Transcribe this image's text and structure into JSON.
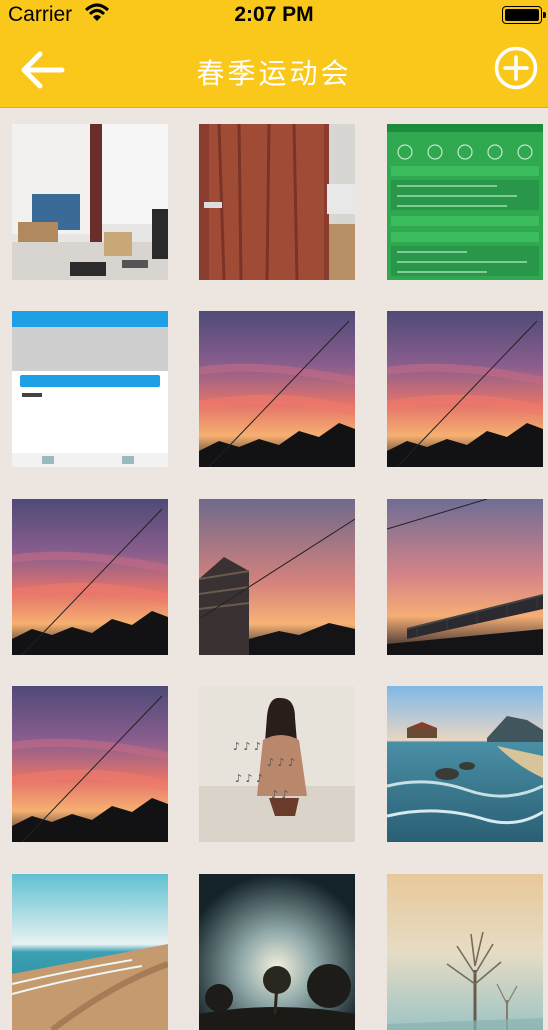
{
  "status": {
    "carrier": "Carrier",
    "time": "2:07 PM"
  },
  "nav": {
    "title": "春季运动会"
  },
  "photos": [
    {
      "kind": "office"
    },
    {
      "kind": "door"
    },
    {
      "kind": "green-app"
    },
    {
      "kind": "white-app"
    },
    {
      "kind": "sunset"
    },
    {
      "kind": "sunset"
    },
    {
      "kind": "sunset"
    },
    {
      "kind": "sunset-building"
    },
    {
      "kind": "sunset-bridge"
    },
    {
      "kind": "sunset"
    },
    {
      "kind": "girl"
    },
    {
      "kind": "seaside"
    },
    {
      "kind": "beach"
    },
    {
      "kind": "dark-tree"
    },
    {
      "kind": "misty-tree"
    }
  ],
  "icons": {
    "back": "back-arrow-icon",
    "add": "add-circle-icon",
    "wifi": "wifi-icon",
    "battery": "battery-icon"
  },
  "colors": {
    "accent": "#f9c81a",
    "background": "#ede6e0"
  }
}
